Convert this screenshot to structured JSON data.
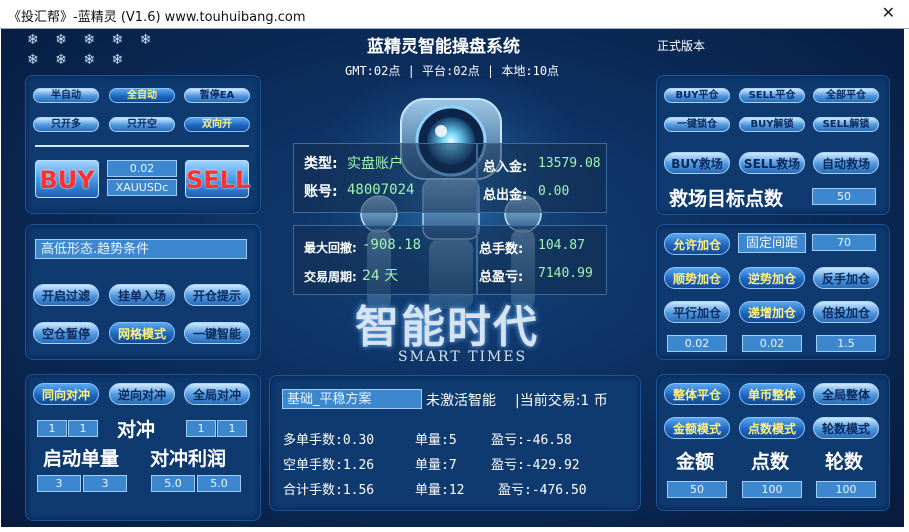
{
  "window": {
    "title": "《投汇帮》-蓝精灵 (V1.6) www.touhuibang.com",
    "close_label": "✕"
  },
  "header": {
    "stars": "❄ ❄ ❄ ❄ ❄",
    "stars2": "❄ ❄ ❄ ❄",
    "app_title": "蓝精灵智能操盘系统",
    "time_line": "GMT:02点 | 平台:02点 | 本地:10点",
    "version": "正式版本"
  },
  "left_top": {
    "row1": [
      "半自动",
      "全自动",
      "暂停EA"
    ],
    "row2": [
      "只开多",
      "只开空",
      "双向开"
    ],
    "buy": "BUY",
    "sell": "SELL",
    "lot": "0.02",
    "symbol": "XAUUSDc"
  },
  "left_mid": {
    "condition": "高低形态.趋势条件",
    "row1": [
      "开启过滤",
      "挂单入场",
      "开仓提示"
    ],
    "row2": [
      "空仓暂停",
      "网格模式",
      "一键智能"
    ]
  },
  "left_bottom": {
    "row1": [
      "同向对冲",
      "逆向对冲",
      "全局对冲"
    ],
    "hedge_label": "对冲",
    "hedge_vals": [
      "1",
      "1",
      "1",
      "1"
    ],
    "start_lot_label": "启动单量",
    "hedge_profit_label": "对冲利润",
    "start_vals": [
      "3",
      "3"
    ],
    "profit_vals": [
      "5.0",
      "5.0"
    ]
  },
  "center": {
    "account_type_label": "类型:",
    "account_type": "实盘账户",
    "account_label": "账号:",
    "account_no": "48007024",
    "deposit_label": "总入金:",
    "deposit": "13579.08",
    "withdraw_label": "总出金:",
    "withdraw": "0.00",
    "drawdown_label": "最大回撤:",
    "drawdown": "-908.18",
    "lots_label": "总手数:",
    "lots": "104.87",
    "period_label": "交易周期:",
    "period": "24 天",
    "profit_label": "总盈亏:",
    "profit": "7140.99",
    "slogan": "智能时代",
    "slogan_en": "SMART TIMES"
  },
  "bottom_center": {
    "plan": "基础_平稳方案",
    "status": "未激活智能",
    "current": "|当前交易:1 币",
    "rows": [
      {
        "a": "多单手数:0.30",
        "b": "单量:5",
        "c": "盈亏:-46.58"
      },
      {
        "a": "空单手数:1.26",
        "b": "单量:7",
        "c": "盈亏:-429.92"
      },
      {
        "a": "合计手数:1.56",
        "b": "单量:12",
        "c": "盈亏:-476.50"
      }
    ]
  },
  "right_top": {
    "row1": [
      "BUY平仓",
      "SELL平仓",
      "全部平仓"
    ],
    "row2": [
      "一键锁仓",
      "BUY解锁",
      "SELL解锁"
    ],
    "row3": [
      "BUY救场",
      "SELL救场",
      "自动救场"
    ],
    "rescue_label": "救场目标点数",
    "rescue_val": "50"
  },
  "right_mid": {
    "row1_a": "允许加仓",
    "row1_b": "固定间距",
    "row1_val": "70",
    "row2": [
      "顺势加仓",
      "逆势加仓",
      "反手加仓"
    ],
    "row3": [
      "平行加仓",
      "递增加仓",
      "倍投加仓"
    ],
    "vals": [
      "0.02",
      "0.02",
      "1.5"
    ]
  },
  "right_bottom": {
    "row1": [
      "整体平仓",
      "单币整体",
      "全局整体"
    ],
    "row2": [
      "金额模式",
      "点数模式",
      "轮数模式"
    ],
    "labels": [
      "金额",
      "点数",
      "轮数"
    ],
    "vals": [
      "50",
      "100",
      "100"
    ]
  }
}
